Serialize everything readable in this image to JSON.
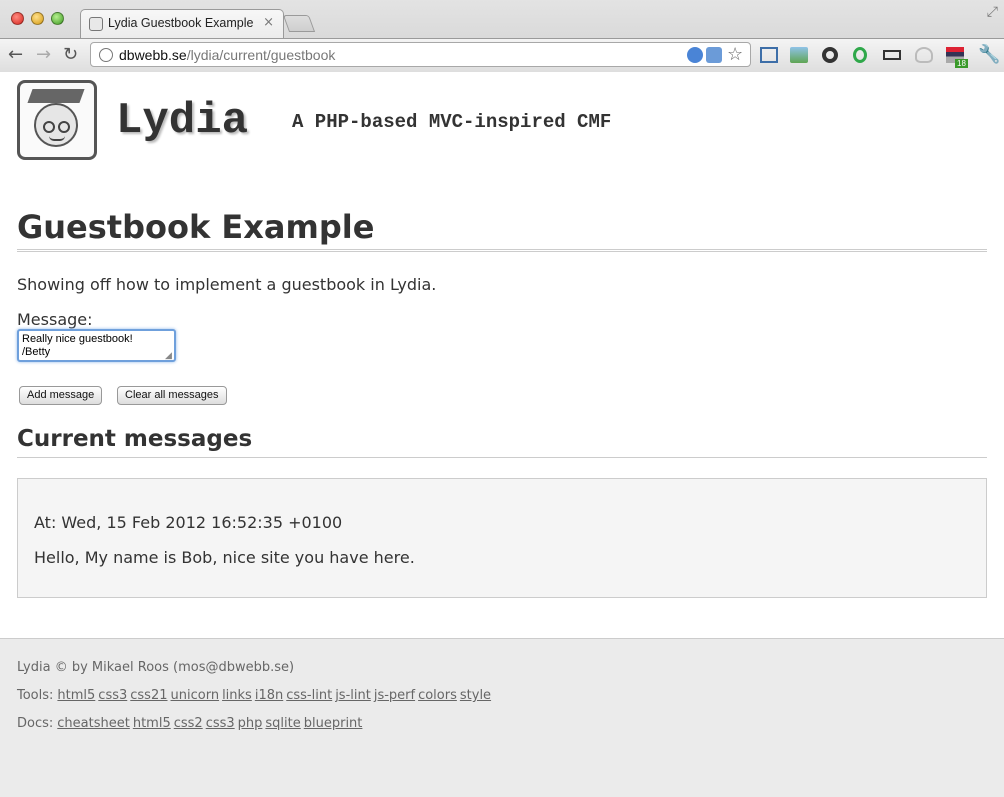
{
  "browser": {
    "tab_title": "Lydia Guestbook Example",
    "tab_close": "×",
    "url_host": "dbwebb.se",
    "url_path": "/lydia/current/guestbook",
    "extension_badge": "18"
  },
  "header": {
    "site_title": "Lydia",
    "slogan": "A PHP-based MVC-inspired CMF"
  },
  "main": {
    "title": "Guestbook Example",
    "intro": "Showing off how to implement a guestbook in Lydia.",
    "message_label": "Message:",
    "message_value": "Really nice guestbook!\n/Betty",
    "add_button": "Add message",
    "clear_button": "Clear all messages",
    "messages_title": "Current messages",
    "messages": [
      {
        "time": "At: Wed, 15 Feb 2012 16:52:35 +0100",
        "text": "Hello, My name is Bob, nice site you have here."
      }
    ]
  },
  "footer": {
    "copyright": "Lydia © by Mikael Roos (mos@dbwebb.se)",
    "tools_label": "Tools:",
    "tools": [
      "html5",
      "css3",
      "css21",
      "unicorn",
      "links",
      "i18n",
      "css-lint",
      "js-lint",
      "js-perf",
      "colors",
      "style"
    ],
    "docs_label": "Docs:",
    "docs": [
      "cheatsheet",
      "html5",
      "css2",
      "css3",
      "php",
      "sqlite",
      "blueprint"
    ]
  }
}
